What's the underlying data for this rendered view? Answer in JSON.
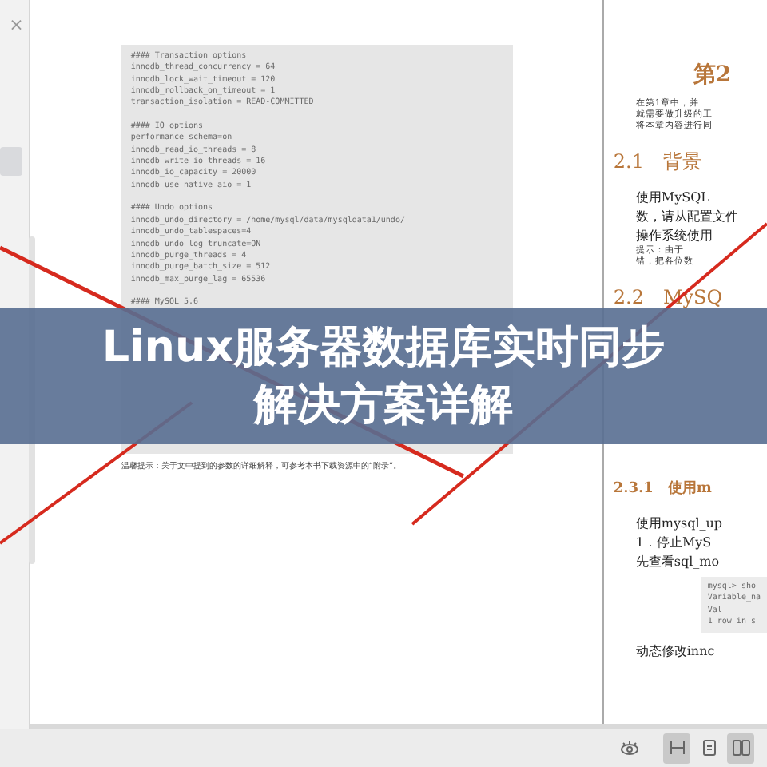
{
  "sidebar": {
    "close": "×",
    "items": [
      {
        "selected": true
      }
    ]
  },
  "left_page": {
    "code_groups": [
      [
        "#### Transaction options",
        "innodb_thread_concurrency = 64",
        "innodb_lock_wait_timeout = 120",
        "innodb_rollback_on_timeout = 1",
        "transaction_isolation = READ-COMMITTED"
      ],
      [
        "#### IO options",
        "performance_schema=on",
        "innodb_read_io_threads = 8",
        "innodb_write_io_threads = 16",
        "innodb_io_capacity = 20000",
        "innodb_use_native_aio = 1"
      ],
      [
        "#### Undo options",
        "innodb_undo_directory = /home/mysql/data/mysqldata1/undo/",
        "innodb_undo_tablespaces=4",
        "innodb_undo_log_truncate=ON",
        "innodb_purge_threads = 4",
        "innodb_purge_batch_size = 512",
        "innodb_max_purge_lag = 65536"
      ],
      [
        "#### MySQL 5.6"
      ]
    ],
    "caption": "温馨提示：关于文中提到的参数的详细解释，可参考本书下载资源中的“附录”。"
  },
  "right_page": {
    "blocks": [
      {
        "kind": "chapter",
        "text": "第2"
      },
      {
        "kind": "small",
        "text": "在第1章中，并"
      },
      {
        "kind": "small",
        "text": "就需要做升级的工"
      },
      {
        "kind": "small",
        "text": "将本章内容进行同"
      },
      {
        "kind": "heading",
        "text": "2.1　背景"
      },
      {
        "kind": "body",
        "text": "使用MySQL"
      },
      {
        "kind": "body",
        "text": "数，请从配置文件"
      },
      {
        "kind": "body",
        "text": "操作系统使用"
      },
      {
        "kind": "small",
        "text": "提示：由于"
      },
      {
        "kind": "small",
        "text": "错，把各位数"
      },
      {
        "kind": "heading",
        "text": "2.2　MySQ"
      },
      {
        "kind": "subheading",
        "text": "2.3.1　使用m"
      },
      {
        "kind": "body",
        "text": "使用mysql_up"
      },
      {
        "kind": "body",
        "text": "1．停止MyS"
      },
      {
        "kind": "body",
        "text": "先查看sql_mo"
      },
      {
        "kind": "code",
        "lines": [
          "mysql> sho",
          "Variable_na",
          "Val",
          "1 row in s"
        ]
      },
      {
        "kind": "body",
        "text": "动态修改innc"
      }
    ]
  },
  "banner": {
    "title_lines": [
      "Linux服务器数据库实时同步",
      "解决方案详解"
    ]
  },
  "toolbar": {
    "buttons": [
      {
        "kind": "eye",
        "selected": false
      },
      {
        "kind": "fit",
        "selected": true
      },
      {
        "kind": "single",
        "selected": false
      },
      {
        "kind": "double",
        "selected": true
      }
    ]
  }
}
